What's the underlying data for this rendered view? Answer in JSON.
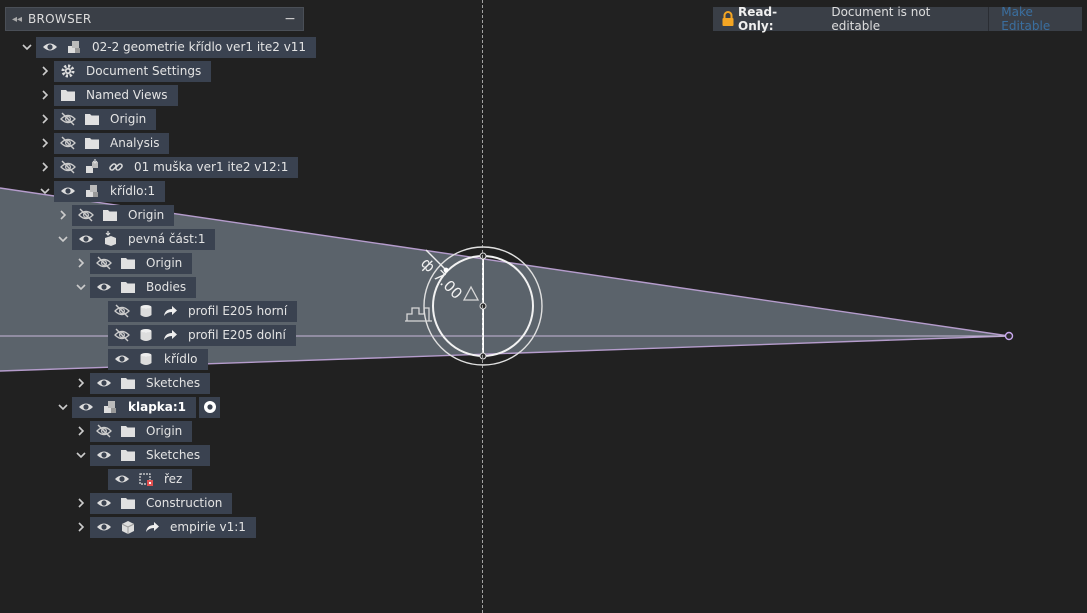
{
  "browser": {
    "title": "BROWSER",
    "items": [
      {
        "label": "02-2 geometrie křídlo ver1 ite2 v11"
      },
      {
        "label": "Document Settings"
      },
      {
        "label": "Named Views"
      },
      {
        "label": "Origin"
      },
      {
        "label": "Analysis"
      },
      {
        "label": "01 muška ver1 ite2 v12:1"
      },
      {
        "label": "křídlo:1"
      },
      {
        "label": "Origin"
      },
      {
        "label": "pevná část:1"
      },
      {
        "label": "Origin"
      },
      {
        "label": "Bodies"
      },
      {
        "label": "profil E205 horní"
      },
      {
        "label": "profil E205 dolní"
      },
      {
        "label": "křídlo"
      },
      {
        "label": "Sketches"
      },
      {
        "label": "klapka:1"
      },
      {
        "label": "Origin"
      },
      {
        "label": "Sketches"
      },
      {
        "label": "řez"
      },
      {
        "label": "Construction"
      },
      {
        "label": "empirie v1:1"
      }
    ]
  },
  "banner": {
    "label": "Read-Only:",
    "message": "Document is not editable",
    "action": "Make Editable"
  },
  "dimension": {
    "text": "ф 7.00"
  },
  "colors": {
    "canvas": "#212121",
    "chip": "#3a4250",
    "wing_fill": "#6b7680",
    "wing_edge": "#b59ccc",
    "lock": "#f5a623",
    "link": "#3a6fa0"
  }
}
